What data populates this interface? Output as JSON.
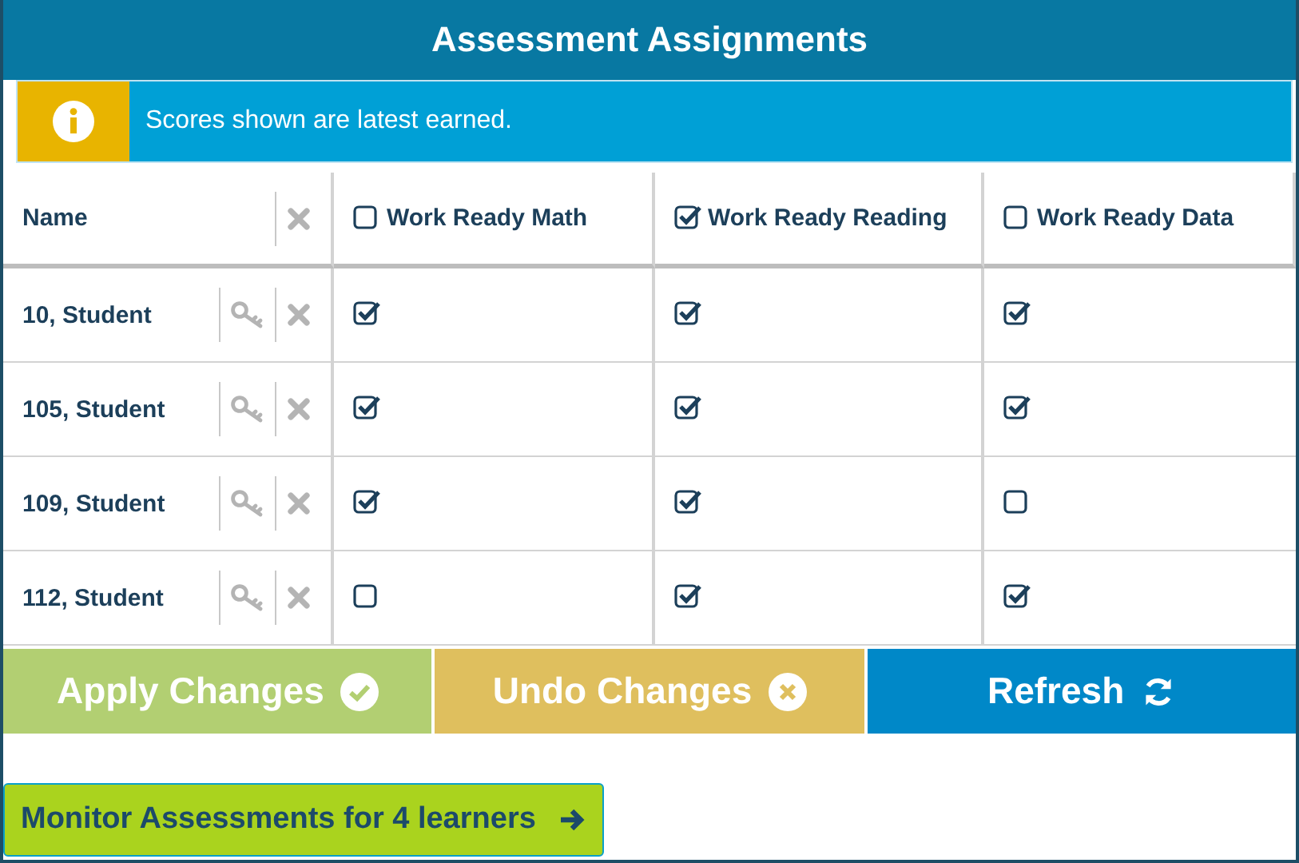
{
  "window": {
    "title": "Assessment Assignments"
  },
  "info": {
    "message": "Scores shown are latest earned."
  },
  "table": {
    "name_header": "Name",
    "columns": [
      {
        "label": "Work Ready Math",
        "checked": false
      },
      {
        "label": "Work Ready Reading",
        "checked": true
      },
      {
        "label": "Work Ready Data",
        "checked": false
      }
    ],
    "rows": [
      {
        "name": "10, Student",
        "assigned": [
          true,
          true,
          true
        ]
      },
      {
        "name": "105, Student",
        "assigned": [
          true,
          true,
          true
        ]
      },
      {
        "name": "109, Student",
        "assigned": [
          true,
          true,
          false
        ]
      },
      {
        "name": "112, Student",
        "assigned": [
          false,
          true,
          true
        ]
      }
    ]
  },
  "actions": [
    {
      "label": "Apply Changes",
      "kind": "apply",
      "disabled": true
    },
    {
      "label": "Undo Changes",
      "kind": "undo",
      "disabled": true
    },
    {
      "label": "Refresh",
      "kind": "refresh",
      "disabled": false
    }
  ],
  "monitor_button": {
    "label": "Monitor Assessments for 4 learners"
  }
}
